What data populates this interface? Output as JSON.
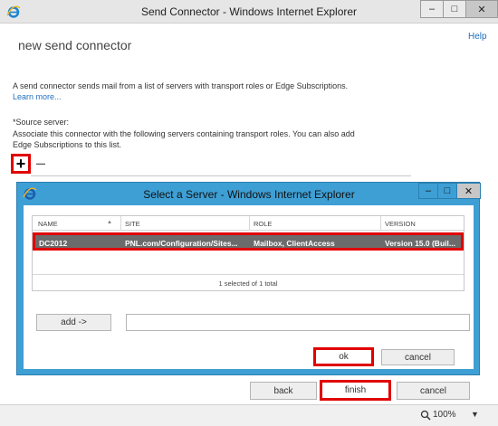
{
  "window": {
    "title": "Send Connector - Windows Internet Explorer",
    "controls": {
      "minimize": "–",
      "maximize": "□",
      "close": "✕"
    }
  },
  "page": {
    "help_link": "Help",
    "title": "new send connector",
    "description": "A send connector sends mail from a list of servers with transport roles or Edge Subscriptions.",
    "learn_more": "Learn more...",
    "source_server_label": "*Source server:",
    "source_server_desc": "Associate this connector with the following servers containing transport roles. You can also add Edge Subscriptions to this list.",
    "add_symbol": "+",
    "remove_symbol": "–"
  },
  "dialog": {
    "title": "Select a Server - Windows Internet Explorer",
    "controls": {
      "minimize": "–",
      "maximize": "□",
      "close": "✕"
    },
    "columns": [
      "NAME",
      "SITE",
      "ROLE",
      "VERSION"
    ],
    "sort_indicator": "▲",
    "rows": [
      {
        "name": "DC2012",
        "site": "PNL.com/Configuration/Sites...",
        "role": "Mailbox, ClientAccess",
        "version": "Version 15.0 (Buil..."
      }
    ],
    "selection_status": "1 selected of 1 total",
    "add_button": "add ->",
    "ok_button": "ok",
    "cancel_button": "cancel"
  },
  "footer": {
    "back_button": "back",
    "finish_button": "finish",
    "cancel_button": "cancel"
  },
  "statusbar": {
    "zoom": "100%",
    "zoom_dropdown": "▼"
  },
  "colors": {
    "highlight": "#e00000",
    "dialog_frame": "#3e9fd4",
    "selected_row": "#6b6b6b",
    "link": "#1f6fbf"
  },
  "icons": {
    "window_icon": "ie-logo-icon",
    "dialog_icon": "ie-logo-icon",
    "zoom_icon": "magnifier-icon"
  }
}
